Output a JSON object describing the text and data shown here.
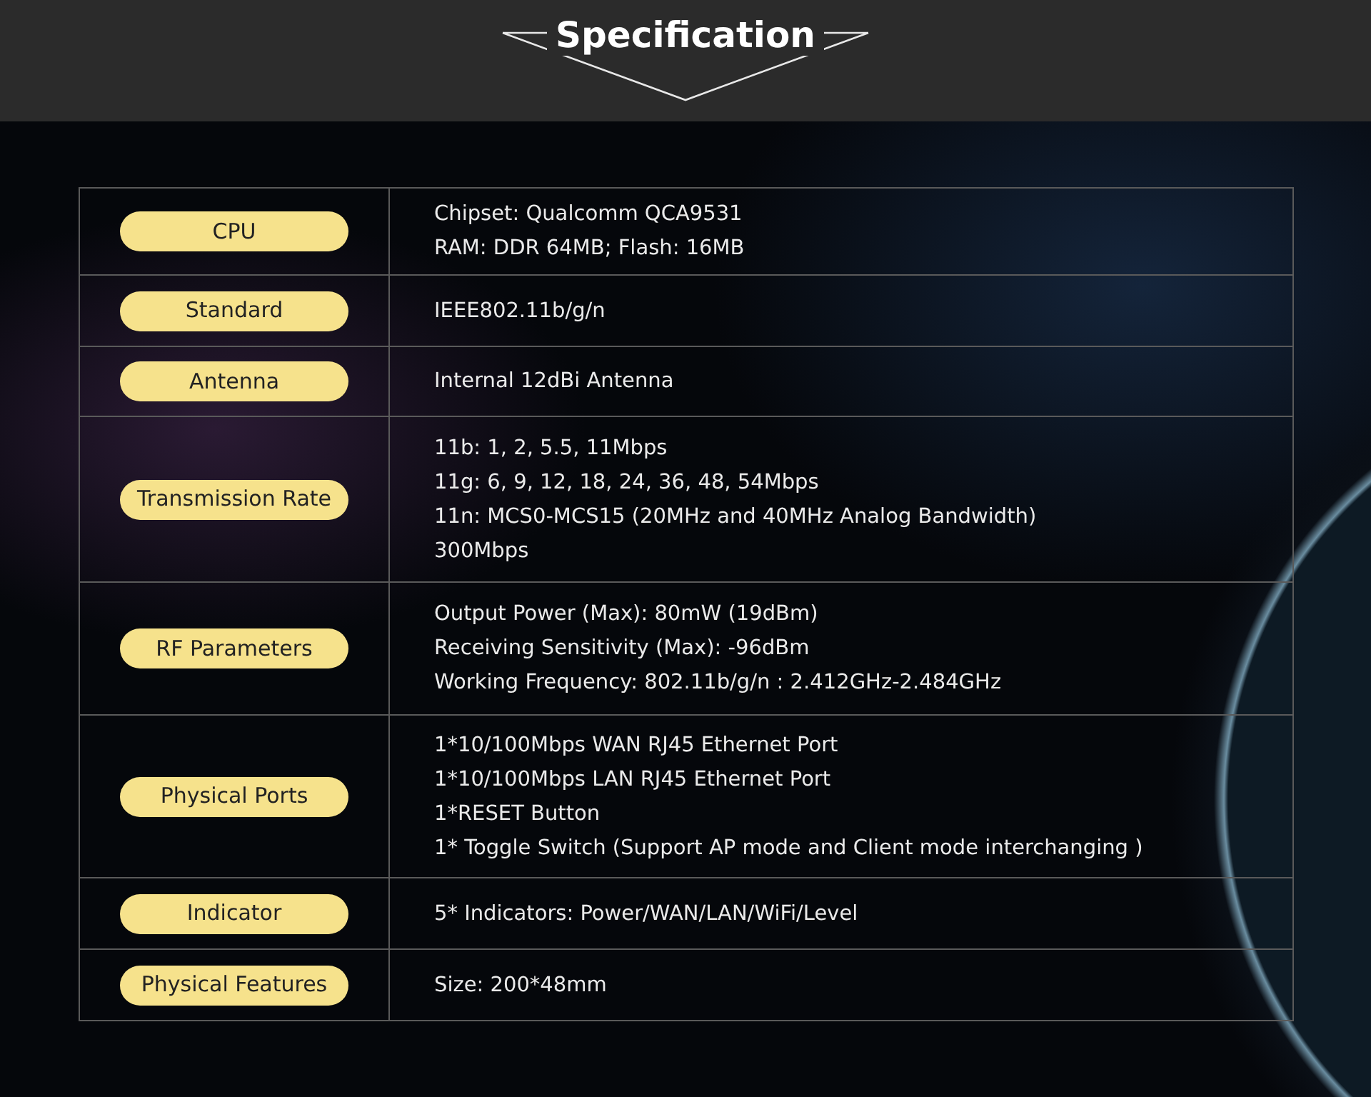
{
  "header": {
    "title": "Specification"
  },
  "specs": [
    {
      "label": "CPU",
      "lines": [
        "Chipset: Qualcomm QCA9531",
        "RAM: DDR 64MB; Flash: 16MB"
      ]
    },
    {
      "label": "Standard",
      "lines": [
        "IEEE802.11b/g/n"
      ]
    },
    {
      "label": "Antenna",
      "lines": [
        "Internal 12dBi Antenna"
      ]
    },
    {
      "label": "Transmission Rate",
      "lines": [
        "11b: 1, 2, 5.5, 11Mbps",
        "11g: 6, 9, 12, 18, 24, 36, 48, 54Mbps",
        "11n: MCS0-MCS15 (20MHz and 40MHz Analog Bandwidth)",
        "300Mbps"
      ]
    },
    {
      "label": "RF Parameters",
      "lines": [
        "Output Power (Max): 80mW (19dBm)",
        "Receiving Sensitivity (Max): -96dBm",
        "Working Frequency:  802.11b/g/n : 2.412GHz-2.484GHz"
      ]
    },
    {
      "label": "Physical Ports",
      "lines": [
        "1*10/100Mbps WAN RJ45 Ethernet Port",
        "1*10/100Mbps LAN RJ45 Ethernet Port",
        "1*RESET Button",
        "1* Toggle Switch (Support AP mode and Client mode interchanging )"
      ]
    },
    {
      "label": "Indicator",
      "lines": [
        "5* Indicators: Power/WAN/LAN/WiFi/Level"
      ]
    },
    {
      "label": "Physical Features",
      "lines": [
        "Size: 200*48mm"
      ]
    }
  ]
}
